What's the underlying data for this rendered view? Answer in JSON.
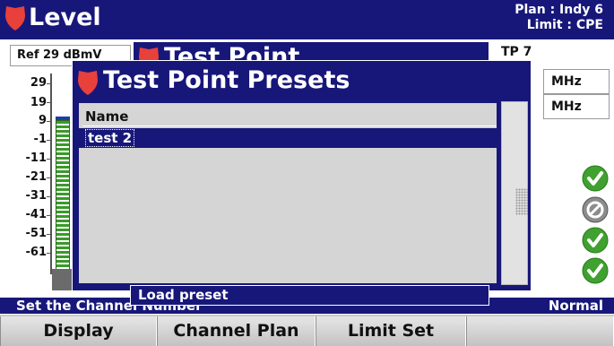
{
  "header": {
    "title": "Level",
    "plan_line": "Plan : Indy 6",
    "limit_line": "Limit : CPE",
    "logo_icon": "red-shield-icon",
    "background_color": "#17177a"
  },
  "ref_level": "Ref 29 dBmV",
  "test_point": "TP 7",
  "freq_fields": [
    "MHz",
    "MHz"
  ],
  "scale": {
    "labels": [
      "29",
      "19",
      "9",
      "-1",
      "-11",
      "-21",
      "-31",
      "-41",
      "-51",
      "-61"
    ]
  },
  "status_icons": [
    "check-circle-icon",
    "blocked-circle-icon",
    "check-circle-icon",
    "check-circle-icon"
  ],
  "background_dialog": {
    "title": "Test Point"
  },
  "dialog": {
    "title": "Test Point Presets",
    "column_header": "Name",
    "rows": [
      "test 2"
    ]
  },
  "load_preset_label": "Load preset",
  "status_bar": {
    "left": "Set the Channel Number",
    "right": "Normal"
  },
  "softkeys": [
    "Display",
    "Channel Plan",
    "Limit Set",
    ""
  ],
  "colors": {
    "accent_blue": "#17177a",
    "shield_red": "#e8403a",
    "ok_green": "#3fa12f",
    "meter_green": "#3a9a2a"
  }
}
